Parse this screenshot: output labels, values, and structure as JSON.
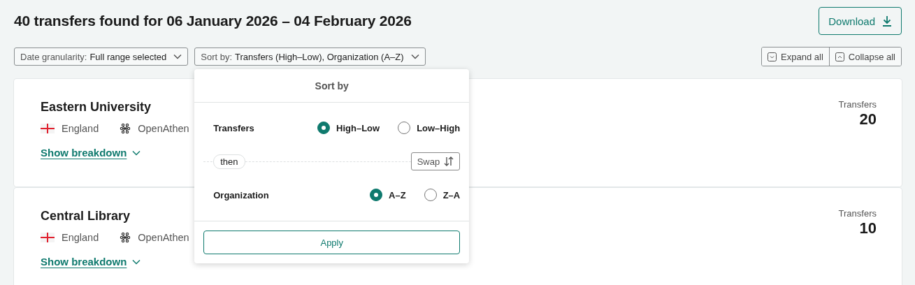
{
  "title": "40 transfers found for 06 January 2026 – 04 February 2026",
  "download": {
    "label": "Download"
  },
  "filters": [
    {
      "label": "Date granularity:",
      "value": "Full range selected"
    },
    {
      "label": "Sort by:",
      "value": "Transfers (High–Low), Organization (A–Z)"
    }
  ],
  "expand_all": "Expand all",
  "collapse_all": "Collapse all",
  "results": [
    {
      "name": "Eastern University",
      "country": "England",
      "federation": "OpenAthen",
      "breakdown_link": "Show breakdown",
      "count_label": "Transfers",
      "count": "20"
    },
    {
      "name": "Central Library",
      "country": "England",
      "federation": "OpenAthen",
      "breakdown_link": "Show breakdown",
      "count_label": "Transfers",
      "count": "10"
    }
  ],
  "sort_popup": {
    "title": "Sort by",
    "criteria": [
      {
        "label": "Transfers",
        "options": [
          {
            "label": "High–Low",
            "selected": true
          },
          {
            "label": "Low–High",
            "selected": false
          }
        ]
      },
      {
        "label": "Organization",
        "options": [
          {
            "label": "A–Z",
            "selected": true
          },
          {
            "label": "Z–A",
            "selected": false
          }
        ]
      }
    ],
    "connector": "then",
    "swap": "Swap",
    "apply": "Apply"
  }
}
